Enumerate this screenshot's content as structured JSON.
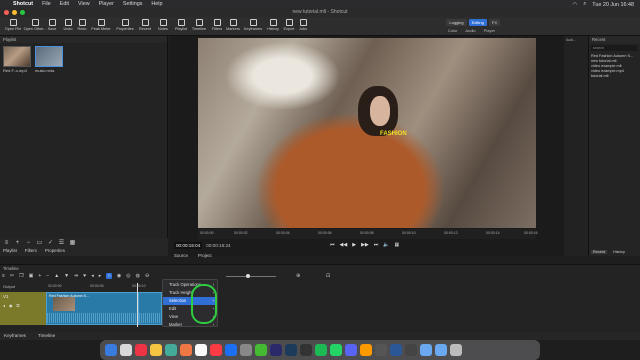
{
  "menubar": {
    "app": "Shotcut",
    "items": [
      "File",
      "Edit",
      "View",
      "Player",
      "Settings",
      "Help"
    ],
    "clock": "Tue 20 Jun  16:48"
  },
  "window": {
    "title": "new tutorial.mlt - Shotcut"
  },
  "toolbar": {
    "items": [
      "Open File",
      "Open Other...",
      "Save",
      "Undo",
      "Redo",
      "Peak Meter",
      "Properties",
      "Recent",
      "Notes",
      "Playlist",
      "Timeline",
      "Filters",
      "Markers",
      "Keyframes",
      "History",
      "Export",
      "Jobs"
    ],
    "layouts": [
      "Logging",
      "Editing",
      "FX"
    ],
    "layout_active": "Editing",
    "layout_sub": [
      "Color",
      "Audio",
      "Player"
    ]
  },
  "playlist": {
    "title": "Playlist",
    "clips": [
      {
        "name": "Red F..o.mp4",
        "selected": false
      },
      {
        "name": "music.m4a",
        "selected": true
      }
    ],
    "tabs": [
      "Playlist",
      "Filters",
      "Properties"
    ]
  },
  "player": {
    "overlay_text": "FASHION",
    "ruler_ticks": [
      "00:00:00",
      "00:00:02",
      "00:00:04",
      "00:00:06",
      "00:00:08",
      "00:00:10",
      "00:00:12",
      "00:00:14",
      "00:00:16"
    ],
    "timecode": "00:00:15:04",
    "duration": "00:00:18:24",
    "tabs": [
      "Source",
      "Project"
    ]
  },
  "audio_meter": {
    "title": "Audi..."
  },
  "recent": {
    "title": "Recent",
    "search_placeholder": "search",
    "items": [
      "Red Fashion Autumn S...",
      "new tutorial.mlt",
      "video example.mlt",
      "video example.mp4",
      "tutorial.mlt"
    ],
    "tabs": [
      "Recent",
      "History"
    ],
    "tab_active": "Recent"
  },
  "timeline": {
    "title": "Timeline",
    "output_label": "Output",
    "track": {
      "name": "V1"
    },
    "ruler_ticks": [
      "00:00:00",
      "00:00:05",
      "00:00:10"
    ],
    "clip_name": "Red Fashion Autumn S..."
  },
  "context_menu": {
    "items": [
      {
        "label": "Track Operations",
        "submenu": true,
        "highlighted": false
      },
      {
        "label": "Track Height",
        "submenu": true,
        "highlighted": false
      },
      {
        "label": "Selection",
        "submenu": true,
        "highlighted": true
      },
      {
        "label": "Edit",
        "submenu": true,
        "highlighted": false
      },
      {
        "label": "View",
        "submenu": true,
        "highlighted": false
      },
      {
        "label": "Marker",
        "submenu": true,
        "highlighted": false
      }
    ]
  },
  "bottom_tabs": [
    "Keyframes",
    "Timeline"
  ],
  "colors": {
    "accent": "#2f6fd6",
    "highlight_ring": "#2ecc40",
    "track_color": "#7a7a2a",
    "clip_color": "#2a7aa8"
  }
}
